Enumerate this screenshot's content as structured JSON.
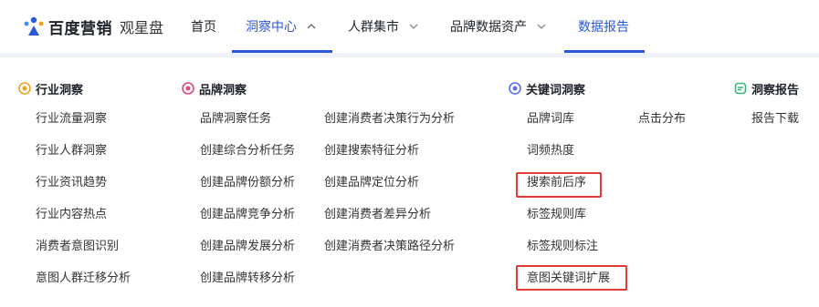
{
  "brand": {
    "name": "百度营销",
    "product": "观星盘"
  },
  "nav": [
    {
      "label": "首页"
    },
    {
      "label": "洞察中心"
    },
    {
      "label": "人群集市"
    },
    {
      "label": "品牌数据资产"
    },
    {
      "label": "数据报告"
    }
  ],
  "sections": {
    "industry": {
      "title": "行业洞察",
      "items": [
        "行业流量洞察",
        "行业人群洞察",
        "行业资讯趋势",
        "行业内容热点",
        "消费者意图识别",
        "意图人群迁移分析"
      ]
    },
    "brand": {
      "title": "品牌洞察",
      "col1": [
        "品牌洞察任务",
        "创建综合分析任务",
        "创建品牌份额分析",
        "创建品牌竞争分析",
        "创建品牌发展分析",
        "创建品牌转移分析"
      ],
      "col2": [
        "创建消费者决策行为分析",
        "创建搜索特征分析",
        "创建品牌定位分析",
        "创建消费者差异分析",
        "创建消费者决策路径分析"
      ]
    },
    "keyword": {
      "title": "关键词洞察",
      "col1": [
        "品牌词库",
        "词频热度",
        "搜索前后序",
        "标签规则库",
        "标签规则标注",
        "意图关键词扩展"
      ],
      "col2": [
        "点击分布"
      ]
    },
    "report": {
      "title": "洞察报告",
      "items": [
        "报告下载"
      ]
    }
  },
  "colors": {
    "accent": "#2b57d8",
    "highlight": "#e53935",
    "industry_icon": "#f0a020",
    "brand_icon": "#e0457b",
    "keyword_icon": "#5b6ef0",
    "report_icon": "#3bb37a"
  }
}
